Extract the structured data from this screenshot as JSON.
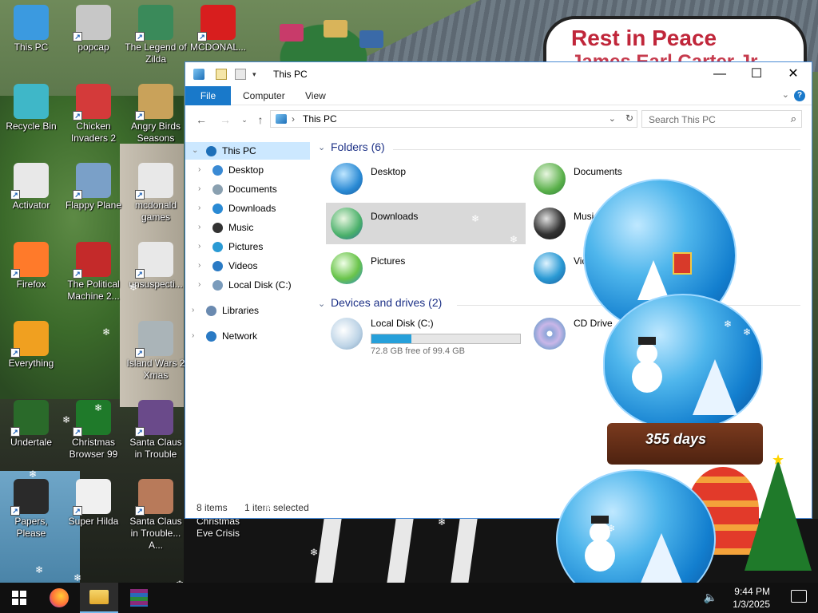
{
  "wallpaper": {
    "sign_line1": "Rest in Peace",
    "sign_line2": "James Earl Carter Jr.",
    "days_label": "355 days"
  },
  "desktop_icons": [
    {
      "label": "This PC",
      "icon": "this-pc-icon"
    },
    {
      "label": "popcap",
      "icon": "popcap-icon"
    },
    {
      "label": "The Legend of Zilda",
      "icon": "zilda-icon"
    },
    {
      "label": "MCDONAL...",
      "icon": "mcdonalds-icon"
    },
    {
      "label": "Recycle Bin",
      "icon": "recycle-bin-icon"
    },
    {
      "label": "Chicken Invaders 2",
      "icon": "chicken-invaders-icon"
    },
    {
      "label": "Angry Birds Seasons",
      "icon": "angry-birds-icon"
    },
    {
      "label": "Activator",
      "icon": "file-icon"
    },
    {
      "label": "Flappy Plane",
      "icon": "flappy-plane-icon"
    },
    {
      "label": "mcdonald games",
      "icon": "file-icon"
    },
    {
      "label": "Firefox",
      "icon": "firefox-icon"
    },
    {
      "label": "The Political Machine 2...",
      "icon": "political-machine-icon"
    },
    {
      "label": "unsuspecti...",
      "icon": "file-icon"
    },
    {
      "label": "Everything",
      "icon": "everything-icon"
    },
    {
      "label": "Island Wars 2 Xmas",
      "icon": "island-wars-icon"
    },
    {
      "label": "Undertale",
      "icon": "undertale-icon"
    },
    {
      "label": "Christmas Browser 99",
      "icon": "christmas-browser-icon"
    },
    {
      "label": "Santa Claus in Trouble",
      "icon": "santa-claus-icon"
    },
    {
      "label": "Papers, Please",
      "icon": "papers-please-icon"
    },
    {
      "label": "Super Hilda",
      "icon": "super-hilda-icon"
    },
    {
      "label": "Santa Claus in Trouble... A...",
      "icon": "santa-claus-icon"
    },
    {
      "label": "Christmas Eve Crisis",
      "icon": "christmas-eve-icon"
    }
  ],
  "explorer": {
    "title": "This PC",
    "ribbon_tabs": [
      "File",
      "Computer",
      "View"
    ],
    "address": "This PC",
    "search_placeholder": "Search This PC",
    "nav": [
      {
        "label": "This PC",
        "selected": true,
        "level": 0
      },
      {
        "label": "Desktop",
        "level": 1
      },
      {
        "label": "Documents",
        "level": 1
      },
      {
        "label": "Downloads",
        "level": 1
      },
      {
        "label": "Music",
        "level": 1
      },
      {
        "label": "Pictures",
        "level": 1
      },
      {
        "label": "Videos",
        "level": 1
      },
      {
        "label": "Local Disk (C:)",
        "level": 1
      },
      {
        "label": "Libraries",
        "level": 0
      },
      {
        "label": "Network",
        "level": 0
      }
    ],
    "folders_header": "Folders (6)",
    "folders": [
      {
        "label": "Desktop",
        "icon": "desktop-folder-icon"
      },
      {
        "label": "Documents",
        "icon": "documents-folder-icon"
      },
      {
        "label": "Downloads",
        "icon": "downloads-folder-icon",
        "selected": true
      },
      {
        "label": "Music",
        "icon": "music-folder-icon"
      },
      {
        "label": "Pictures",
        "icon": "pictures-folder-icon"
      },
      {
        "label": "Videos",
        "icon": "videos-folder-icon"
      }
    ],
    "drives_header": "Devices and drives (2)",
    "drives": [
      {
        "label": "Local Disk (C:)",
        "free_text": "72.8 GB free of 99.4 GB",
        "used_fraction": 0.27,
        "icon": "hard-disk-icon"
      },
      {
        "label": "CD Drive",
        "icon": "cd-drive-icon"
      }
    ],
    "status": {
      "items": "8 items",
      "selected": "1 item selected"
    }
  },
  "taskbar": {
    "apps": [
      "start-icon",
      "firefox-icon",
      "file-explorer-icon",
      "winrar-icon"
    ],
    "time": "9:44 PM",
    "date": "1/3/2025"
  },
  "colors": {
    "accent": "#1979ca",
    "selection": "#cce8ff",
    "header_text": "#1e3287",
    "drive_fill": "#26a0da"
  }
}
